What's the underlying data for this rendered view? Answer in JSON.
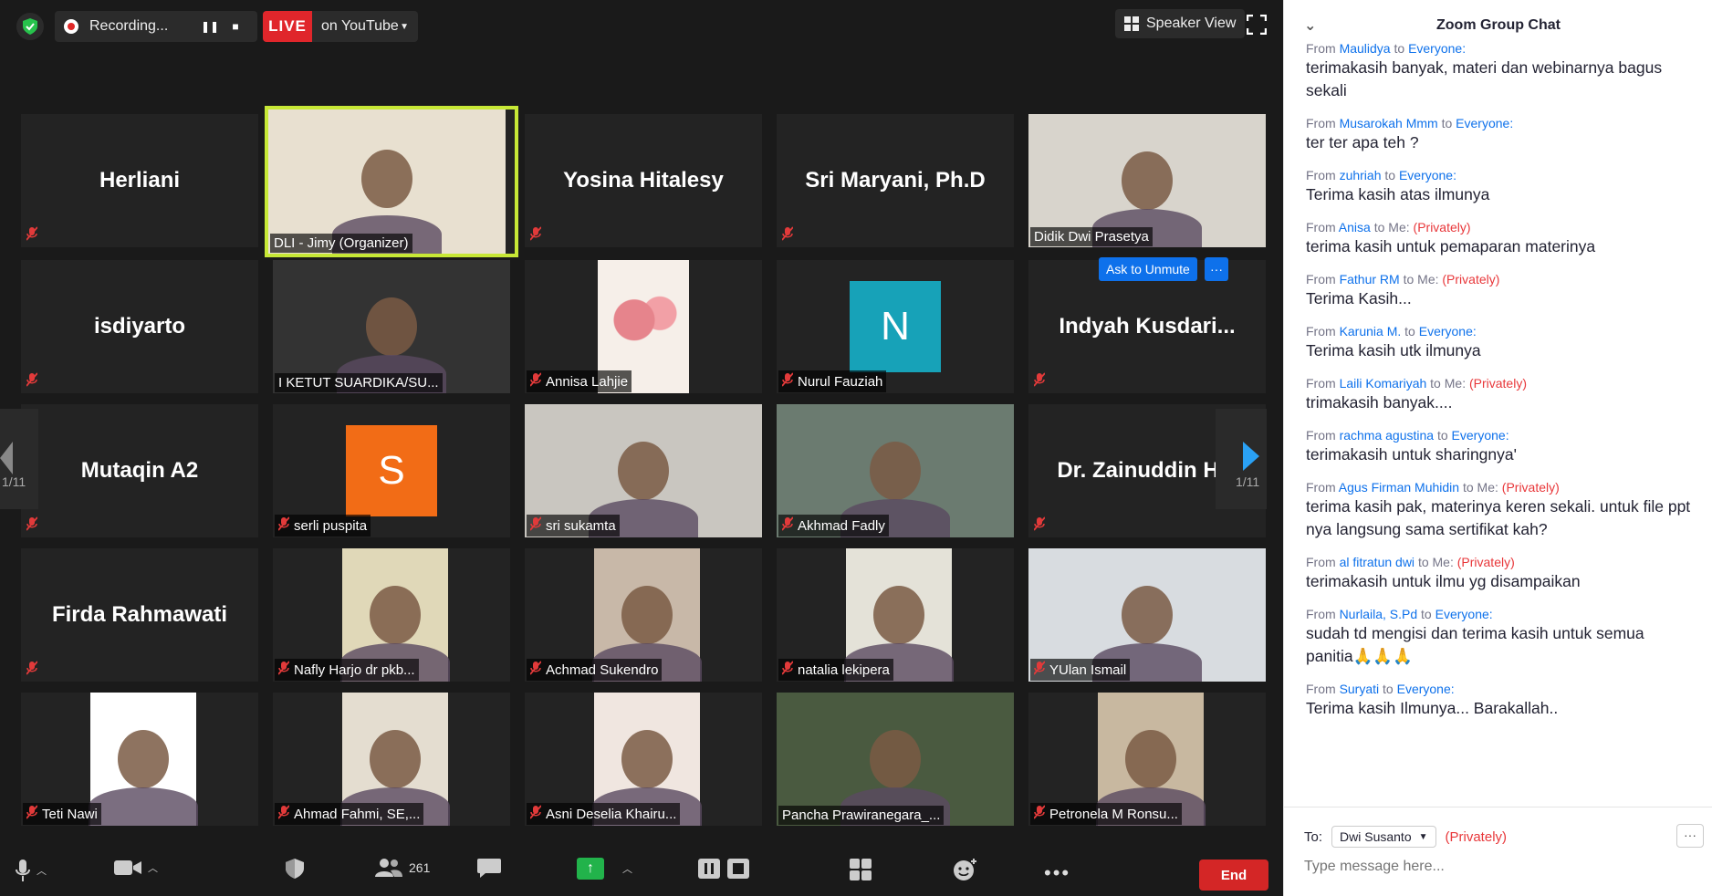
{
  "topbar": {
    "recording_label": "Recording...",
    "live_badge": "LIVE",
    "live_target": "on YouTube",
    "speaker_view_label": "Speaker View"
  },
  "tiles": [
    {
      "name": "Herliani",
      "label": "",
      "muted": true,
      "kind": "name"
    },
    {
      "name": "",
      "label": "DLI - Jimy (Organizer)",
      "muted": false,
      "kind": "video",
      "active": true
    },
    {
      "name": "Yosina Hitalesy",
      "label": "",
      "muted": true,
      "kind": "name"
    },
    {
      "name": "Sri Maryani, Ph.D",
      "label": "",
      "muted": true,
      "kind": "name"
    },
    {
      "name": "",
      "label": "Didik Dwi Prasetya",
      "muted": false,
      "kind": "video"
    },
    {
      "name": "isdiyarto",
      "label": "",
      "muted": true,
      "kind": "name"
    },
    {
      "name": "",
      "label": "I KETUT SUARDIKA/SU...",
      "muted": false,
      "kind": "video"
    },
    {
      "name": "",
      "label": "Annisa Lahjie",
      "muted": true,
      "kind": "photo"
    },
    {
      "name": "N",
      "label": "Nurul Fauziah",
      "muted": true,
      "kind": "avatar"
    },
    {
      "name": "Indyah Kusdari...",
      "label": "",
      "muted": true,
      "kind": "name"
    },
    {
      "name": "Mutaqin A2",
      "label": "",
      "muted": true,
      "kind": "name"
    },
    {
      "name": "S",
      "label": "serli puspita",
      "muted": true,
      "kind": "avatar"
    },
    {
      "name": "",
      "label": "sri sukamta",
      "muted": true,
      "kind": "video"
    },
    {
      "name": "",
      "label": "Akhmad Fadly",
      "muted": true,
      "kind": "video"
    },
    {
      "name": "Dr. Zainuddin H...",
      "label": "",
      "muted": true,
      "kind": "name"
    },
    {
      "name": "Firda Rahmawati",
      "label": "",
      "muted": true,
      "kind": "name"
    },
    {
      "name": "",
      "label": "Nafly Harjo dr pkb...",
      "muted": true,
      "kind": "photo"
    },
    {
      "name": "",
      "label": "Achmad Sukendro",
      "muted": true,
      "kind": "photo"
    },
    {
      "name": "",
      "label": "natalia lekipera",
      "muted": true,
      "kind": "photo"
    },
    {
      "name": "",
      "label": "YUlan Ismail",
      "muted": true,
      "kind": "video"
    },
    {
      "name": "",
      "label": "Teti Nawi",
      "muted": true,
      "kind": "photo"
    },
    {
      "name": "",
      "label": "Ahmad Fahmi, SE,...",
      "muted": true,
      "kind": "photo"
    },
    {
      "name": "",
      "label": "Asni Deselia Khairu...",
      "muted": true,
      "kind": "photo"
    },
    {
      "name": "",
      "label": "Pancha Prawiranegara_...",
      "muted": false,
      "kind": "video"
    },
    {
      "name": "",
      "label": "Petronela M Ronsu...",
      "muted": true,
      "kind": "photo"
    }
  ],
  "pager": {
    "left": "1/11",
    "right": "1/11"
  },
  "tile_actions": {
    "ask_unmute": "Ask to Unmute",
    "more": "···"
  },
  "toolbar": {
    "participants_count": "261",
    "end_label": "End"
  },
  "chat": {
    "title": "Zoom Group Chat",
    "messages": [
      {
        "from": "Maulidya",
        "to": "Everyone:",
        "private": "",
        "text": "terimakasih banyak, materi dan webinarnya bagus sekali"
      },
      {
        "from": "Musarokah Mmm",
        "to": "Everyone:",
        "private": "",
        "text": "ter ter apa teh ?"
      },
      {
        "from": "zuhriah",
        "to": "Everyone:",
        "private": "",
        "text": "Terima kasih atas ilmunya"
      },
      {
        "from": "Anisa",
        "to": "Me:",
        "private": "(Privately)",
        "text": "terima kasih untuk pemaparan materinya"
      },
      {
        "from": "Fathur RM",
        "to": "Me:",
        "private": "(Privately)",
        "text": "Terima Kasih..."
      },
      {
        "from": "Karunia M.",
        "to": "Everyone:",
        "private": "",
        "text": "Terima kasih utk ilmunya"
      },
      {
        "from": "Laili Komariyah",
        "to": "Me:",
        "private": "(Privately)",
        "text": "trimakasih banyak...."
      },
      {
        "from": "rachma agustina",
        "to": "Everyone:",
        "private": "",
        "text": "terimakasih untuk sharingnya'"
      },
      {
        "from": "Agus Firman Muhidin",
        "to": "Me:",
        "private": "(Privately)",
        "text": "terima kasih pak, materinya keren sekali. untuk file ppt nya langsung sama sertifikat kah?"
      },
      {
        "from": "al fitratun dwi",
        "to": "Me:",
        "private": "(Privately)",
        "text": "terimakasih untuk ilmu yg disampaikan"
      },
      {
        "from": "Nurlaila, S.Pd",
        "to": "Everyone:",
        "private": "",
        "text": "sudah td mengisi  dan terima kasih untuk semua panitia🙏🙏🙏"
      },
      {
        "from": "Suryati",
        "to": "Everyone:",
        "private": "",
        "text": "Terima kasih Ilmunya... Barakallah.."
      }
    ],
    "from_word": "From",
    "to_word": "to",
    "to_label": "To:",
    "to_recipient": "Dwi Susanto",
    "to_private": "(Privately)",
    "input_placeholder": "Type message here...",
    "more": "···"
  },
  "colors": {
    "accent": "#0e71eb",
    "live": "#e0262b",
    "end": "#d42626",
    "active_speaker": "#c7e836",
    "muted": "#e23a3a"
  }
}
